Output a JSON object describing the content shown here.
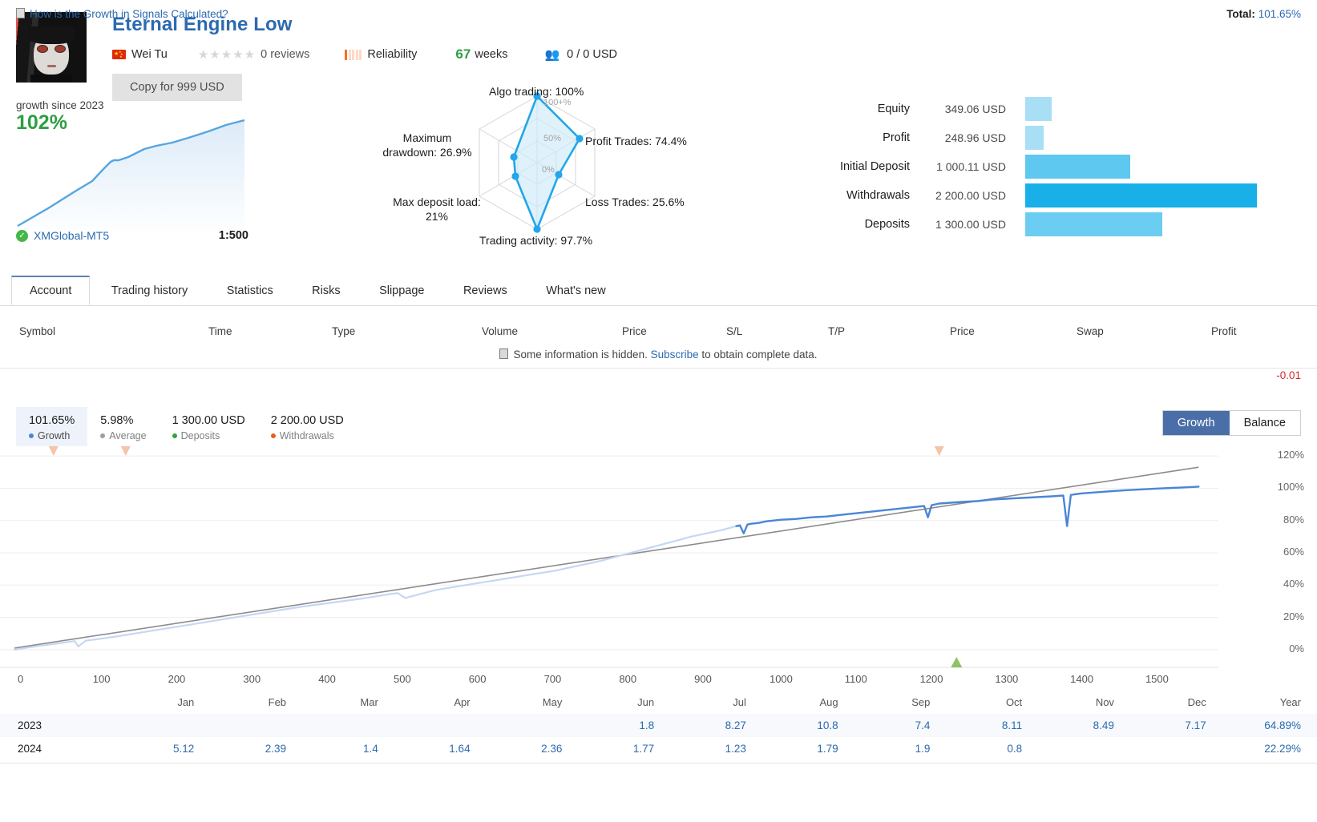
{
  "header": {
    "title": "Eternal Engine Low",
    "avatar_alt": "anime-portrait-avatar",
    "author": "Wei Tu",
    "flag": "china-flag-icon",
    "stars": "★★★★★",
    "reviews": "0 reviews",
    "reliability_label": "Reliability",
    "weeks_number": "67",
    "weeks_label": "weeks",
    "subscribers_icon": "subscribers-icon",
    "subscribers": "0 / 0 USD",
    "copy_button": "Copy for 999 USD"
  },
  "mini_chart": {
    "label": "growth since 2023",
    "value": "102%",
    "broker": "XMGlobal-MT5",
    "broker_verified_icon": "verified-check-icon",
    "leverage": "1:500"
  },
  "radar": {
    "labels": {
      "algo": "Algo trading: 100%",
      "profit_trades": "Profit Trades: 74.4%",
      "loss_trades": "Loss Trades: 25.6%",
      "trading_activity": "Trading activity: 97.7%",
      "max_deposit_load": "Max deposit load:\n21%",
      "max_drawdown": "Maximum\ndrawdown: 26.9%"
    },
    "rings": [
      "100+%",
      "50%",
      "0%"
    ]
  },
  "stats": {
    "rows": [
      {
        "name": "Equity",
        "value": "349.06 USD",
        "pct": 9.0,
        "color": "#a9dff5"
      },
      {
        "name": "Profit",
        "value": "248.96 USD",
        "pct": 6.4,
        "color": "#a9dff5"
      },
      {
        "name": "Initial Deposit",
        "value": "1 000.11 USD",
        "pct": 36.0,
        "color": "#5fc8f0"
      },
      {
        "name": "Withdrawals",
        "value": "2 200.00 USD",
        "pct": 79.5,
        "color": "#19afe8"
      },
      {
        "name": "Deposits",
        "value": "1 300.00 USD",
        "pct": 47.0,
        "color": "#6ccdf2"
      }
    ]
  },
  "tabs": [
    {
      "label": "Account",
      "active": true
    },
    {
      "label": "Trading history",
      "active": false
    },
    {
      "label": "Statistics",
      "active": false
    },
    {
      "label": "Risks",
      "active": false
    },
    {
      "label": "Slippage",
      "active": false
    },
    {
      "label": "Reviews",
      "active": false
    },
    {
      "label": "What's new",
      "active": false
    }
  ],
  "deal_table": {
    "columns": [
      {
        "label": "Symbol",
        "x": 24
      },
      {
        "label": "Time",
        "x": 260
      },
      {
        "label": "Type",
        "x": 414
      },
      {
        "label": "Volume",
        "x": 601
      },
      {
        "label": "Price",
        "x": 776
      },
      {
        "label": "S/L",
        "x": 906
      },
      {
        "label": "T/P",
        "x": 1033
      },
      {
        "label": "Price",
        "x": 1185
      },
      {
        "label": "Swap",
        "x": 1343
      },
      {
        "label": "Profit",
        "x": 1511
      }
    ],
    "hidden_note_prefix": "Some information is hidden.",
    "hidden_note_link": "Subscribe",
    "hidden_note_suffix": "to obtain complete data.",
    "summary_profit": "-0.01"
  },
  "legend": [
    {
      "value": "101.65%",
      "label": "Growth",
      "color": "#4a86d6",
      "selected": true
    },
    {
      "value": "5.98%",
      "label": "Average",
      "color": "#9e9e9e",
      "selected": false
    },
    {
      "value": "1 300.00 USD",
      "label": "Deposits",
      "color": "#3aa03a",
      "selected": false
    },
    {
      "value": "2 200.00 USD",
      "label": "Withdrawals",
      "color": "#e8601c",
      "selected": false
    }
  ],
  "chart_toggle": {
    "growth": "Growth",
    "balance": "Balance",
    "selected": "Growth"
  },
  "chart_data": {
    "type": "line",
    "title": "",
    "xlabel": "",
    "ylabel": "",
    "xlim": [
      0,
      1580
    ],
    "ylim": [
      -5,
      125
    ],
    "grid": true,
    "legend_position": "top-left",
    "yticks": [
      "120%",
      "100%",
      "80%",
      "60%",
      "40%",
      "20%",
      "0%"
    ],
    "ytick_values": [
      120,
      100,
      80,
      60,
      40,
      20,
      0
    ],
    "xticks": [
      "0",
      "100",
      "200",
      "300",
      "400",
      "500",
      "600",
      "700",
      "800",
      "900",
      "1000",
      "1100",
      "1200",
      "1300",
      "1400",
      "1500"
    ],
    "xtick_values": [
      0,
      100,
      200,
      300,
      400,
      500,
      600,
      700,
      800,
      900,
      1000,
      1100,
      1200,
      1300,
      1400,
      1500
    ],
    "series": [
      {
        "name": "Growth",
        "color": "#4a86d6",
        "x": [
          0,
          20,
          40,
          60,
          75,
          80,
          85,
          95,
          110,
          140,
          180,
          220,
          260,
          300,
          340,
          380,
          420,
          460,
          500,
          510,
          520,
          560,
          600,
          640,
          680,
          700,
          720,
          740,
          760,
          780,
          800,
          820,
          840,
          860,
          880,
          900,
          920,
          940,
          960,
          965,
          970,
          975,
          980,
          990,
          1000,
          1020,
          1040,
          1060,
          1080,
          1100,
          1120,
          1140,
          1160,
          1180,
          1200,
          1210,
          1215,
          1220,
          1225,
          1230,
          1245,
          1260,
          1280,
          1290,
          1300,
          1320,
          1340,
          1360,
          1380,
          1395,
          1400,
          1405,
          1410,
          1420,
          1440,
          1460,
          1480,
          1500,
          1520,
          1540,
          1560,
          1575
        ],
        "y": [
          0,
          1.5,
          2.8,
          4.0,
          5.0,
          5.3,
          2.0,
          5.6,
          6.5,
          8.5,
          11.5,
          14.5,
          17.5,
          20.5,
          23.5,
          26.5,
          29.0,
          31.5,
          34.5,
          35.0,
          32.0,
          37.0,
          40.0,
          43.0,
          46.0,
          47.5,
          49.0,
          51.0,
          53.0,
          55.0,
          57.5,
          60.0,
          62.5,
          65.0,
          67.5,
          70.0,
          72.0,
          74.0,
          76.5,
          77.0,
          72.0,
          77.5,
          78.0,
          78.5,
          79.5,
          80.5,
          81.0,
          82.0,
          82.5,
          83.5,
          84.5,
          85.5,
          86.5,
          87.5,
          88.5,
          89.0,
          82.0,
          89.5,
          90.0,
          90.5,
          91.0,
          91.5,
          92.0,
          92.5,
          93.0,
          93.5,
          94.0,
          94.5,
          95.0,
          95.5,
          76.5,
          95.8,
          96.2,
          96.8,
          97.5,
          98.2,
          98.8,
          99.3,
          99.8,
          100.2,
          100.6,
          101.0
        ]
      },
      {
        "name": "Average",
        "color": "#8c8c8c",
        "x": [
          0,
          1575
        ],
        "y": [
          1.0,
          113.0
        ]
      }
    ],
    "markers": [
      {
        "type": "withdrawal",
        "x": 52,
        "color": "#f6c3ab"
      },
      {
        "type": "withdrawal",
        "x": 148,
        "color": "#f6c3ab"
      },
      {
        "type": "withdrawal",
        "x": 1230,
        "color": "#f6c3ab"
      },
      {
        "type": "deposit",
        "x": 1253,
        "color": "#79b84a"
      }
    ]
  },
  "month_table": {
    "months": [
      "Jan",
      "Feb",
      "Mar",
      "Apr",
      "May",
      "Jun",
      "Jul",
      "Aug",
      "Sep",
      "Oct",
      "Nov",
      "Dec"
    ],
    "year_col": "Year",
    "rows": [
      {
        "year": "2023",
        "values": [
          "",
          "",
          "",
          "",
          "",
          "1.8",
          "8.27",
          "10.8",
          "7.4",
          "8.11",
          "8.49",
          "7.17"
        ],
        "total": "64.89%"
      },
      {
        "year": "2024",
        "values": [
          "5.12",
          "2.39",
          "1.4",
          "1.64",
          "2.36",
          "1.77",
          "1.23",
          "1.79",
          "1.9",
          "0.8",
          "",
          ""
        ],
        "total": "22.29%"
      }
    ]
  },
  "footer": {
    "link": "How is the Growth in Signals Calculated?",
    "total_label": "Total:",
    "total_value": "101.65%"
  }
}
